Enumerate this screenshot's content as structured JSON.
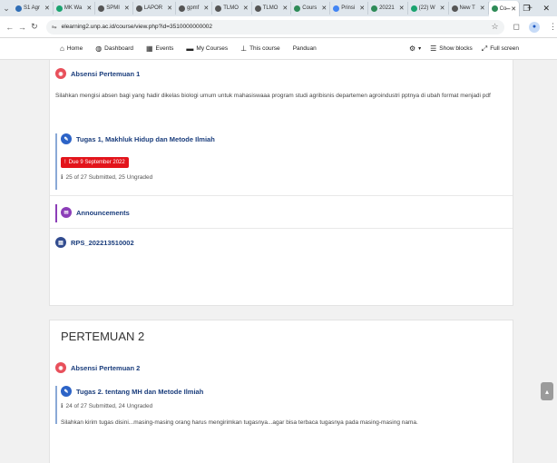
{
  "browser": {
    "tabs": [
      {
        "label": "S1 Agr",
        "color": "#2f6db5"
      },
      {
        "label": "MK Wa",
        "color": "#1aa36f"
      },
      {
        "label": "SPMI",
        "color": "#555555"
      },
      {
        "label": "LAPOR",
        "color": "#555555"
      },
      {
        "label": "gpmf",
        "color": "#555555"
      },
      {
        "label": "TLMO",
        "color": "#555555"
      },
      {
        "label": "TLMO",
        "color": "#555555"
      },
      {
        "label": "Cours",
        "color": "#2e8b57"
      },
      {
        "label": "Prinsi",
        "color": "#4285f4"
      },
      {
        "label": "20221",
        "color": "#2e8b57"
      },
      {
        "label": "(22) W",
        "color": "#1aa36f"
      },
      {
        "label": "New T",
        "color": "#555555"
      },
      {
        "label": "Co",
        "color": "#2e8b57"
      }
    ],
    "new_tab": "+",
    "url": "elearning2.unp.ac.id/course/view.php?id=3510000000002"
  },
  "navbar": {
    "home": "Home",
    "dashboard": "Dashboard",
    "events": "Events",
    "my_courses": "My Courses",
    "this_course": "This course",
    "panduan": "Panduan",
    "show_blocks": "Show blocks",
    "full_screen": "Full screen"
  },
  "section1": {
    "activities": {
      "absensi": {
        "title": "Absensi Pertemuan 1",
        "description": "Silahkan mengisi absen bagi yang hadir dikelas biologi umum untuk mahasiswaaa program studi agribisnis departemen agroindustri pptnya di ubah format menjadi pdf"
      },
      "tugas": {
        "title": "Tugas 1, Makhluk Hidup dan Metode Ilmiah",
        "due": "Due 9 September 2022",
        "submissions": "25 of 27 Submitted, 25 Ungraded"
      },
      "announcements": {
        "title": "Announcements"
      },
      "rps": {
        "title": "RPS_202213510002"
      }
    }
  },
  "section2": {
    "title": "PERTEMUAN 2",
    "activities": {
      "absensi": {
        "title": "Absensi Pertemuan 2"
      },
      "tugas": {
        "title": "Tugas 2. tentang MH dan Metode Ilmiah",
        "submissions": "24 of 27 Submitted, 24 Ungraded",
        "description": "Silahkan kirim tugas disini...masing-masing orang harus mengirimkan tugasnya...agar bisa terbaca tugasnya pada masing-masing nama."
      }
    }
  }
}
